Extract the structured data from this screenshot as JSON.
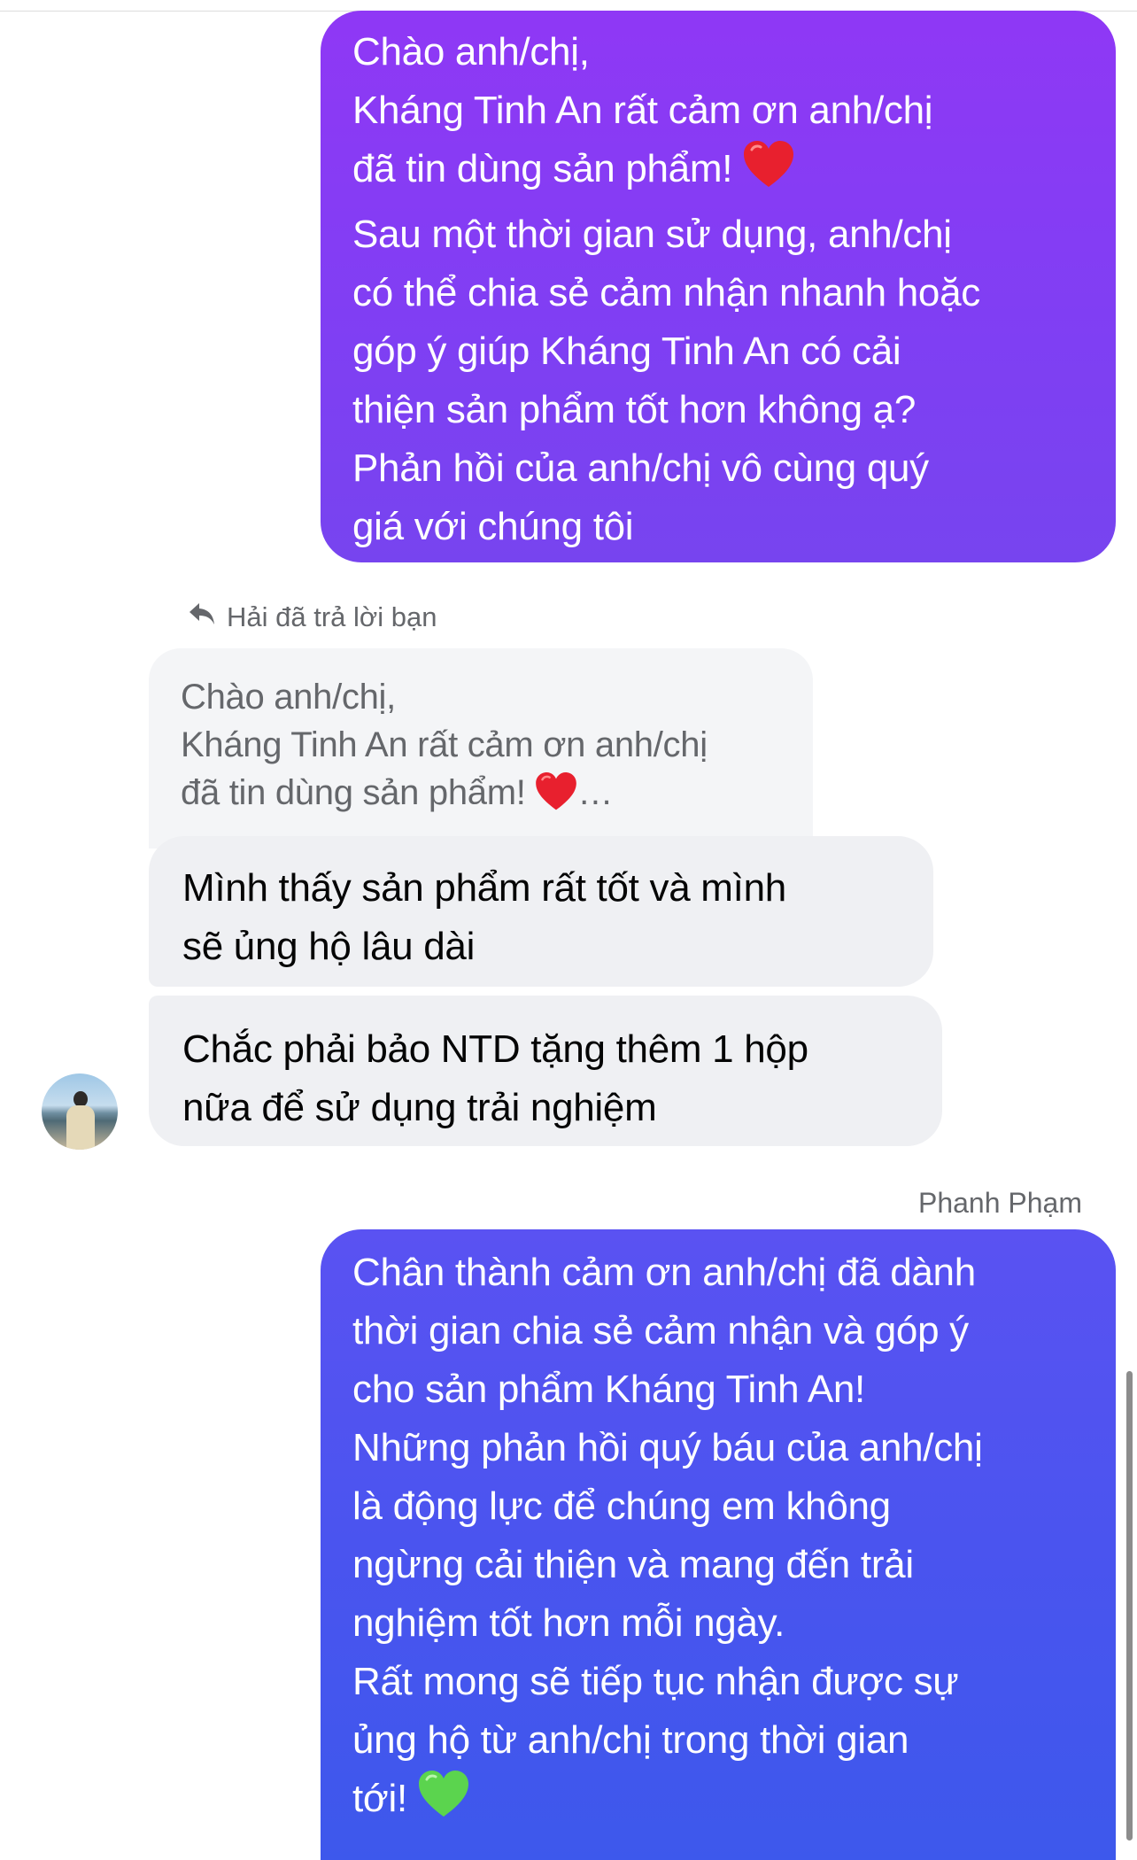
{
  "messages": {
    "outgoing_1": {
      "lines": [
        "Chào anh/chị,",
        "Kháng Tinh An rất cảm ơn anh/chị",
        "đã tin dùng sản phẩm!",
        "Sau một thời gian sử dụng, anh/chị",
        "có thể chia sẻ cảm nhận nhanh hoặc",
        "góp ý giúp Kháng Tinh An có cải",
        "thiện sản phẩm tốt hơn không ạ?",
        "Phản hồi của anh/chị vô cùng quý",
        "giá với chúng tôi"
      ],
      "emoji": "red-heart"
    },
    "reply_indicator": "Hải đã trả lời bạn",
    "quoted": {
      "lines": [
        "Chào anh/chị,",
        "Kháng Tinh An rất cảm ơn anh/chị",
        "đã tin dùng sản phẩm!"
      ],
      "ellipsis": "…",
      "emoji": "red-heart"
    },
    "incoming_1": {
      "lines": [
        "Mình thấy sản phẩm rất tốt và mình",
        "sẽ ủng hộ lâu dài"
      ]
    },
    "incoming_2": {
      "lines": [
        "Chắc phải bảo NTD tặng thêm 1 hộp",
        "nữa để sử dụng trải nghiệm"
      ]
    },
    "sender_name": "Phanh Phạm",
    "outgoing_2": {
      "lines": [
        "Chân thành cảm ơn anh/chị đã dành",
        "thời gian chia sẻ cảm nhận và góp ý",
        "cho sản phẩm Kháng Tinh An!",
        "Những phản hồi quý báu của anh/chị",
        "là động lực để chúng em không",
        "ngừng cải thiện và mang đến trải",
        "nghiệm tốt hơn mỗi ngày.",
        "Rất mong sẽ tiếp tục nhận được sự",
        "ủng hộ từ anh/chị trong thời gian",
        "tới!"
      ],
      "emoji": "green-heart"
    }
  },
  "colors": {
    "outgoing_1_bg": "#8a3cf4",
    "outgoing_2_bg": "#4a54ef",
    "incoming_bg": "#eff0f3",
    "quoted_bg": "#f4f5f7",
    "heart_red": "#e8202e",
    "heart_green": "#5bd44e"
  }
}
